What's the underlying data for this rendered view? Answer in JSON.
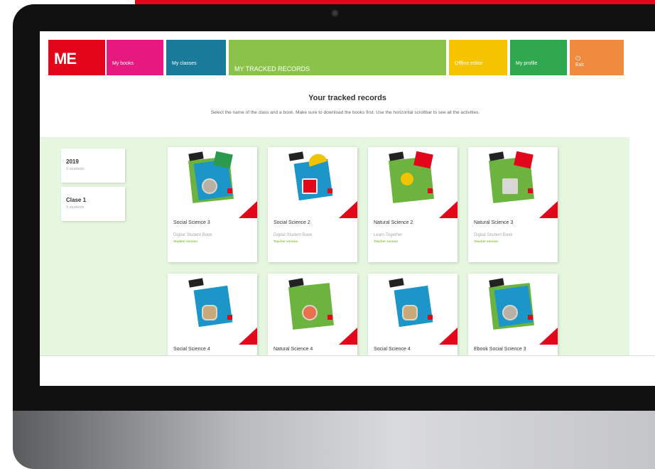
{
  "nav": {
    "logo": "ME",
    "books": "My books",
    "classes": "My classes",
    "tracked": "MY TRACKED RECORDS",
    "offline": "Offline editor",
    "profile": "My profile",
    "exit": "Exit"
  },
  "page": {
    "title": "Your tracked records",
    "subtitle": "Select the name of the class and a book. Make sure to download the books first. Use the horizontal scrollbar to see all the activities."
  },
  "classes": [
    {
      "name": "2019",
      "count": "0 students"
    },
    {
      "name": "Clase 1",
      "count": "0 students"
    }
  ],
  "books": [
    {
      "title": "Social Science 3",
      "edition": "Digital Student Book",
      "version": "Student version"
    },
    {
      "title": "Social Science 2",
      "edition": "Digital Student Book",
      "version": "Teacher version"
    },
    {
      "title": "Natural Science 2",
      "edition": "Learn Together",
      "version": "Teacher version"
    },
    {
      "title": "Natural Science 3",
      "edition": "Digital Student Book",
      "version": "Teacher version"
    },
    {
      "title": "Social Science 4"
    },
    {
      "title": "Natural Science 4"
    },
    {
      "title": "Social Science 4"
    },
    {
      "title": "Ebook Social Science 3"
    }
  ],
  "colors": {
    "brand_red": "#e3061b",
    "books_pink": "#e5197e",
    "classes_blue": "#1a7a9a",
    "tracked_green": "#8bc34a",
    "offline_yellow": "#f5c400",
    "profile_green": "#2fa84f",
    "exit_orange": "#f08a3e",
    "content_bg": "#e6f6df"
  }
}
